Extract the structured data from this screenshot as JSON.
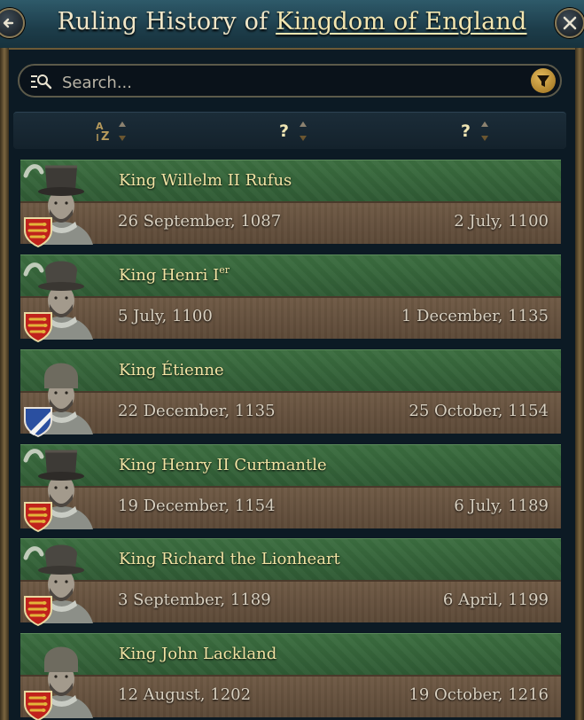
{
  "header": {
    "title_prefix": "Ruling History of",
    "kingdom_link": "Kingdom of England",
    "back_icon": "arrow-left-icon",
    "close_icon": "close-icon"
  },
  "search": {
    "placeholder": "Search...",
    "icon": "search-list-icon",
    "filter_icon": "filter-funnel-icon"
  },
  "sort_bar": {
    "name_sort_icon": "alpha-sort-icon",
    "start_label": "?",
    "end_label": "?"
  },
  "colors": {
    "accent_gold": "#f0e6b4",
    "row_green": "#3c6e40",
    "row_brown": "#6f5a45",
    "england_red": "#c0221c",
    "blois_blue": "#2a4fa0"
  },
  "rulers": [
    {
      "name": "King Willelm II Rufus",
      "suffix": "",
      "start": "26 September, 1087",
      "end": "2 July, 1100",
      "coat_of_arms": "england-lions",
      "headwear": "tall-hat-feather"
    },
    {
      "name": "King Henri I",
      "suffix": "er",
      "start": "5 July, 1100",
      "end": "1 December, 1135",
      "coat_of_arms": "england-lions",
      "headwear": "hat-feather"
    },
    {
      "name": "King Étienne",
      "suffix": "",
      "start": "22 December, 1135",
      "end": "25 October, 1154",
      "coat_of_arms": "blois-bend",
      "headwear": "coif"
    },
    {
      "name": "King Henry II Curtmantle",
      "suffix": "",
      "start": "19 December, 1154",
      "end": "6 July, 1189",
      "coat_of_arms": "england-lions",
      "headwear": "tall-hat-feather"
    },
    {
      "name": "King Richard the Lionheart",
      "suffix": "",
      "start": "3 September, 1189",
      "end": "6 April, 1199",
      "coat_of_arms": "england-lions",
      "headwear": "hat-feather"
    },
    {
      "name": "King John Lackland",
      "suffix": "",
      "start": "12 August, 1202",
      "end": "19 October, 1216",
      "coat_of_arms": "england-lions",
      "headwear": "coif"
    }
  ]
}
